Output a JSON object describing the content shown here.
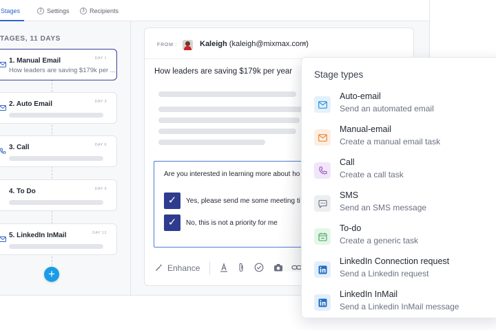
{
  "tabs": [
    {
      "label": "Stages"
    },
    {
      "num": "2",
      "label": "Settings"
    },
    {
      "num": "3",
      "label": "Recipients"
    }
  ],
  "stages_header": "TAGES, 11 DAYS",
  "stages": [
    {
      "title": "1. Manual Email",
      "day": "DAY 1",
      "subtitle": "How leaders are saving $179k per ..."
    },
    {
      "title": "2. Auto Email",
      "day": "DAY 3"
    },
    {
      "title": "3. Call",
      "day": "DAY 6"
    },
    {
      "title": "4. To Do",
      "day": "DAY 9"
    },
    {
      "title": "5. LinkedIn InMail",
      "day": "DAY 12"
    }
  ],
  "add_stage_label": "+",
  "email": {
    "from_label": "FROM :",
    "from_name": "Kaleigh",
    "from_email": "(kaleigh@mixmax.com)",
    "subject": "How leaders are saving $179k per year",
    "poll_question": "Are you interested in learning more about ho",
    "poll_options": [
      "Yes, please send me some meeting ti",
      "No, this is not a priority for me"
    ],
    "enhance_label": "Enhance"
  },
  "stage_types": {
    "title": "Stage types",
    "items": [
      {
        "name": "Auto-email",
        "desc": "Send an automated email",
        "icon": "envelope-icon",
        "bg": "#e4f1fb",
        "color": "#2e8fd6"
      },
      {
        "name": "Manual-email",
        "desc": "Create a manual email task",
        "icon": "envelope-icon",
        "bg": "#fdeee2",
        "color": "#e38a3c"
      },
      {
        "name": "Call",
        "desc": "Create a call task",
        "icon": "phone-icon",
        "bg": "#f1e6f8",
        "color": "#9b4bc9"
      },
      {
        "name": "SMS",
        "desc": "Send an SMS message",
        "icon": "chat-bubble-icon",
        "bg": "#eceef1",
        "color": "#6b7180"
      },
      {
        "name": "To-do",
        "desc": "Create a generic task",
        "icon": "calendar-icon",
        "bg": "#e6f5e9",
        "color": "#3aa65a"
      },
      {
        "name": "LinkedIn Connection request",
        "desc": "Send a Linkedin request",
        "icon": "linkedin-icon",
        "bg": "#e4eefb",
        "color": "#1f6ec2"
      },
      {
        "name": "LinkedIn InMail",
        "desc": "Send a Linkedin InMail message",
        "icon": "linkedin-icon",
        "bg": "#e4eefb",
        "color": "#1f6ec2"
      }
    ]
  }
}
